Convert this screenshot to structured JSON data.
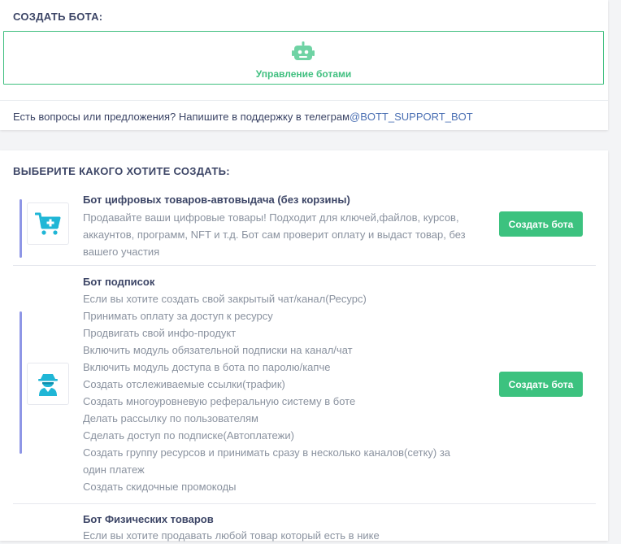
{
  "create_section": {
    "title": "СОЗДАТЬ БОТА:",
    "manage_label": "Управление ботами",
    "manage_icon": "robot-icon"
  },
  "support": {
    "text": "Есть вопросы или предложения? Напишите в поддержку в телеграм",
    "link": "@BOTT_SUPPORT_BOT"
  },
  "choose_section": {
    "title": "ВЫБЕРИТЕ КАКОГО ХОТИТЕ СОЗДАТЬ:"
  },
  "bots": [
    {
      "title": "Бот цифровых товаров-автовыдача (без корзины)",
      "icon": "shopping-cart-plus-icon",
      "button": "Создать бота",
      "lines": [
        "Продавайте ваши цифровые товары! Подходит для ключей,файлов, курсов,",
        "аккаунтов, программ, NFT и т.д. Бот сам проверит оплату и выдаст товар, без",
        "вашего участия"
      ]
    },
    {
      "title": "Бот подписок",
      "icon": "spy-agent-icon",
      "button": "Создать бота",
      "lines": [
        "Если вы хотите создать свой закрытый чат/канал(Ресурс)",
        "Принимать оплату за доступ к ресурсу",
        "Продвигать свой инфо-продукт",
        "Включить модуль обязательной подписки на канал/чат",
        "Включить модуль доступа в бота по паролю/капче",
        "Создать отслеживаемые ссылки(трафик)",
        "Создать многоуровневую реферальную систему в боте",
        "Делать рассылку по пользователям",
        "Сделать доступ по подписке(Автоплатежи)",
        "Создать группу ресурсов и принимать сразу в несколько каналов(сетку) за",
        "один платеж",
        "Создать скидочные промокоды"
      ]
    },
    {
      "title": "Бот Физических товаров",
      "lines": [
        "Если вы хотите продавать любой товар который есть в нике"
      ]
    }
  ],
  "colors": {
    "accent_green": "#3cc27f",
    "accent_bar": "#8e96e6",
    "link": "#4a6fb3"
  }
}
